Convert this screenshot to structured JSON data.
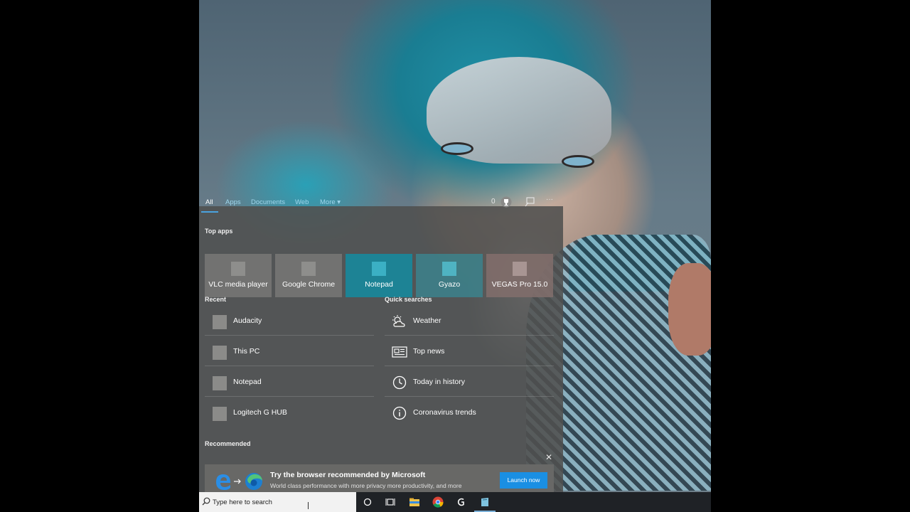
{
  "flyout": {
    "tabs": [
      "All",
      "Apps",
      "Documents",
      "Web",
      "More"
    ],
    "points": "0",
    "sections": {
      "top_apps": "Top apps",
      "recent": "Recent",
      "quick_searches": "Quick searches",
      "recommended": "Recommended"
    },
    "top_apps": [
      "VLC media player",
      "Google Chrome",
      "Notepad",
      "Gyazo",
      "VEGAS Pro 15.0"
    ],
    "recent": [
      "Audacity",
      "This PC",
      "Notepad",
      "Logitech G HUB"
    ],
    "quick_searches": [
      {
        "label": "Weather",
        "icon": "weather-icon"
      },
      {
        "label": "Top news",
        "icon": "news-icon"
      },
      {
        "label": "Today in history",
        "icon": "clock-icon"
      },
      {
        "label": "Coronavirus trends",
        "icon": "info-icon"
      }
    ],
    "recommended_card": {
      "title": "Try the browser recommended by Microsoft",
      "description": "World class performance with more privacy more productivity, and more value while you browse.",
      "button": "Launch now"
    }
  },
  "taskbar": {
    "search_placeholder": "Type here to search",
    "icons": [
      "cortana-icon",
      "task-view-icon",
      "file-explorer-icon",
      "chrome-icon",
      "logitech-icon",
      "app-icon"
    ]
  },
  "colors": {
    "accent": "#1a8fe3",
    "panel": "#50504e",
    "taskbar": "#1f2226"
  }
}
